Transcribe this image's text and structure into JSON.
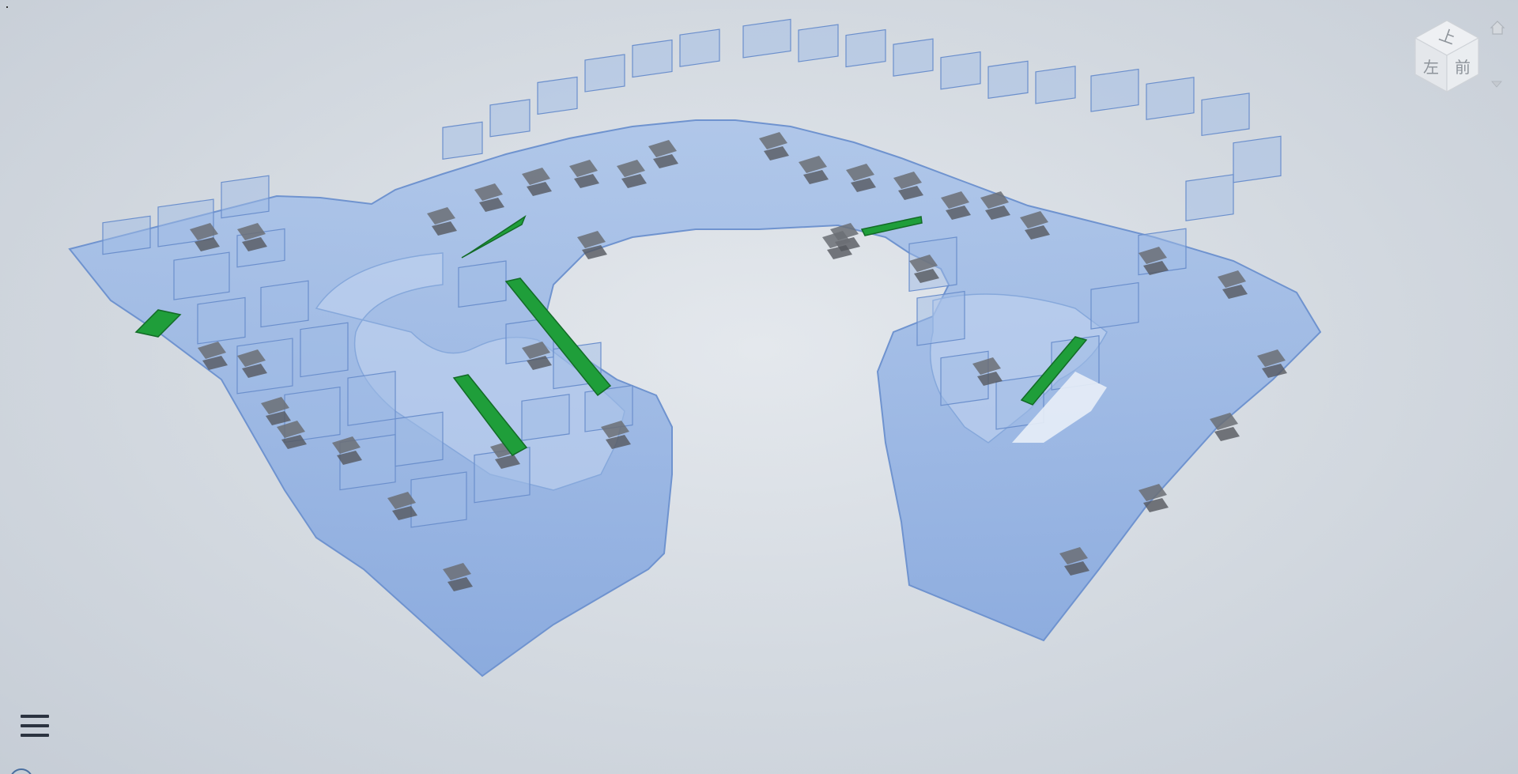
{
  "viewer": {
    "background_color": "#d8dde3",
    "model_color": "#7ea6e0",
    "escalator_color": "#1f9e3a",
    "stair_color": "#6b6e74"
  },
  "viewcube": {
    "top_label": "上",
    "left_label": "左",
    "front_label": "前",
    "home_icon": "home-icon",
    "menu_icon": "chevron-down-icon"
  },
  "toolbar": {
    "menu_icon": "hamburger-menu-icon"
  }
}
